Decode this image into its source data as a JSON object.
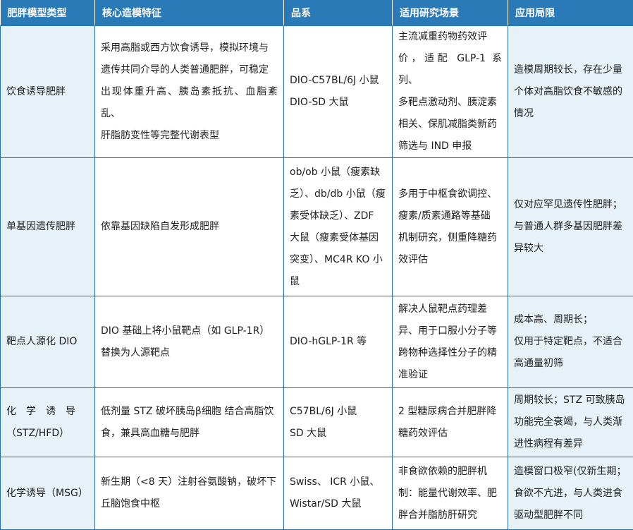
{
  "headers": [
    "肥胖模型类型",
    "核心造模特征",
    "品系",
    "适用研究场景",
    "应用局限"
  ],
  "rows": [
    {
      "type": [
        "饮食诱导肥胖"
      ],
      "feature": [
        "采用高脂或西方饮食诱导，模拟环境与",
        "遗传共同介导的人类普通肥胖，可稳定",
        "出现体重升高、胰岛素抵抗、血脂紊乱、",
        "肝脂肪变性等完整代谢表型"
      ],
      "strain": [
        "DIO-C57BL/6J 小鼠",
        "DIO-SD 大鼠"
      ],
      "scenario": [
        "主流减重药物药效评",
        "价，适配 GLP-1 系列、",
        "多靶点激动剂、胰淀素",
        "相关、保肌减脂类新药",
        "筛选与 IND 申报"
      ],
      "limit": [
        "造模周期较长，存在少量",
        "个体对高脂饮食不敏感的",
        "情况"
      ]
    },
    {
      "type": [
        "单基因遗传肥胖"
      ],
      "feature": [
        "依靠基因缺陷自发形成肥胖"
      ],
      "strain": [
        "ob/ob 小鼠（瘦素缺",
        "乏）、db/db 小鼠（瘦",
        "素受体缺乏）、ZDF",
        "大鼠（瘦素受体基因",
        "突变）、MC4R KO 小",
        "鼠"
      ],
      "scenario": [
        "多用于中枢食欲调控、",
        "瘦素/质素通路等基础",
        "机制研究，侧重降糖药",
        "效评估"
      ],
      "limit": [
        "仅对应罕见遗传性肥胖；",
        "与普通人群多基因肥胖差",
        "异较大"
      ]
    },
    {
      "type": [
        "靶点人源化 DIO"
      ],
      "feature": [
        "DIO 基础上将小鼠靶点（如 GLP-1R）",
        "替换为人源靶点"
      ],
      "strain": [
        "DIO-hGLP-1R 等"
      ],
      "scenario": [
        "解决人鼠靶点药理差",
        "异、用于口服小分子等",
        "跨物种选择性分子的精",
        "准验证"
      ],
      "limit": [
        "成本高、周期长；",
        "仅用于特定靶点，不适合",
        "高通量初筛"
      ]
    },
    {
      "type": [
        "化　学　诱　导",
        "（STZ/HFD）"
      ],
      "feature": [
        "低剂量 STZ 破坏胰岛β细胞 结合高脂饮",
        "食，兼具高血糖与肥胖"
      ],
      "strain": [
        "C57BL/6J 小鼠",
        "SD 大鼠"
      ],
      "scenario": [
        "2 型糖尿病合并肥胖降",
        "糖药效评估"
      ],
      "limit": [
        "周期较长；STZ 可致胰岛",
        "功能完全衰竭，与人类渐",
        "进性病程有差异"
      ]
    },
    {
      "type": [
        "化学诱导（MSG）"
      ],
      "feature": [
        "新生期（<8 天）注射谷氨酸钠，破坏下",
        "丘脑饱食中枢"
      ],
      "strain": [
        "Swiss、 ICR 小鼠、",
        "Wistar/SD 大鼠"
      ],
      "scenario": [
        "非食欲依赖的肥胖机",
        "制：能量代谢效率、肥",
        "胖合并脂肪肝研究"
      ],
      "limit": [
        "造模窗口极窄(仅新生期；",
        "食欲不亢进，与人类进食",
        "驱动型肥胖不同"
      ]
    }
  ],
  "colors": {
    "header_bg": "#2a7ab8",
    "tint_bg": "#e6f1f8",
    "border": "#2a6ea6"
  }
}
